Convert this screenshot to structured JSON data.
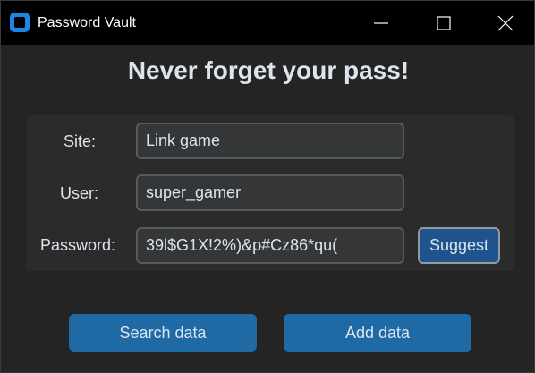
{
  "window": {
    "title": "Password Vault",
    "app_icon": "app-logo-icon",
    "controls": [
      "minimize-icon",
      "maximize-icon",
      "close-icon"
    ]
  },
  "heading": "Never forget your pass!",
  "form": {
    "site": {
      "label": "Site:",
      "value": "Link game"
    },
    "user": {
      "label": "User:",
      "value": "super_gamer"
    },
    "password": {
      "label": "Password:",
      "value": "39l$G1X!2%)&p#Cz86*qu("
    },
    "suggest_label": "Suggest"
  },
  "actions": {
    "search_label": "Search data",
    "add_label": "Add data"
  },
  "colors": {
    "background": "#242424",
    "frame": "#2b2b2b",
    "entry_bg": "#343638",
    "entry_border": "#565b5e",
    "button": "#1f6aa5",
    "suggest_button": "#1f538d",
    "text": "#dce4ee"
  }
}
